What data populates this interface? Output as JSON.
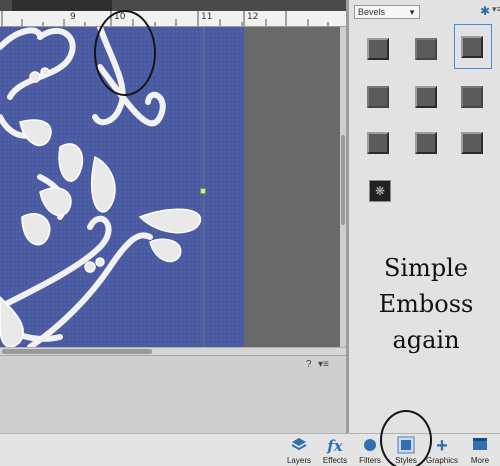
{
  "ruler": {
    "labels": [
      "9",
      "10",
      "11",
      "12"
    ]
  },
  "styles_panel": {
    "category": "Bevels",
    "gear_icon": "gear-icon",
    "caption_lines": [
      "Simple",
      "Emboss",
      "again"
    ]
  },
  "taskbar": {
    "items": [
      {
        "label": "Layers",
        "icon": "layers-icon"
      },
      {
        "label": "Effects",
        "icon": "fx-icon",
        "glyph": "fx"
      },
      {
        "label": "Filters",
        "icon": "filters-icon"
      },
      {
        "label": "Styles",
        "icon": "styles-icon"
      },
      {
        "label": "Graphics",
        "icon": "plus-icon",
        "glyph": "+"
      },
      {
        "label": "More",
        "icon": "more-icon"
      }
    ]
  },
  "lower_panel": {
    "help_glyph": "?",
    "menu_glyph": "▾≡"
  },
  "colors": {
    "canvas": "#4b5ca3",
    "accent": "#3f8fd6",
    "panel": "#e2e2e2"
  }
}
